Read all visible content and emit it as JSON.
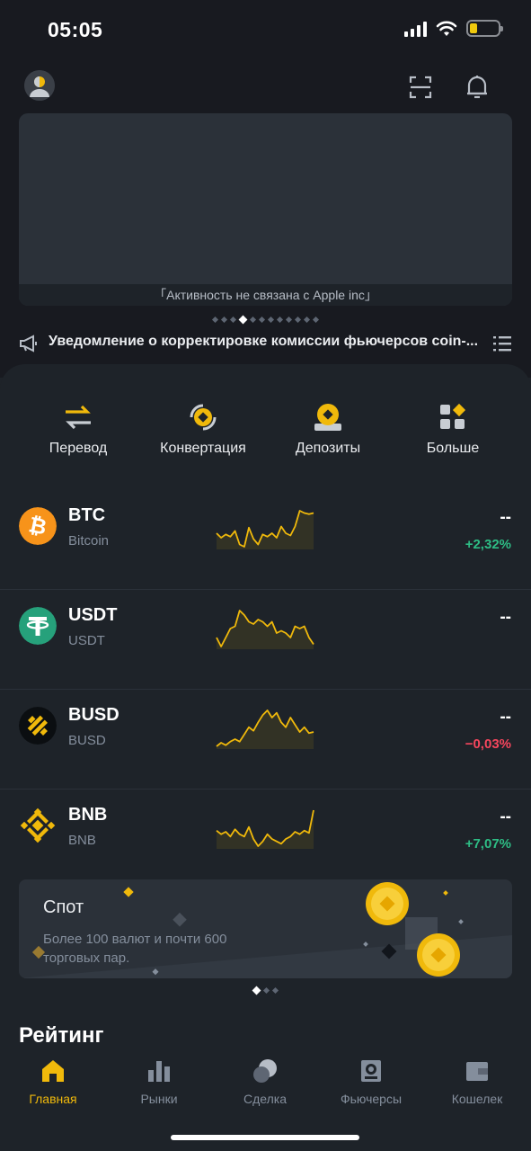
{
  "status": {
    "time": "05:05"
  },
  "banner": {
    "caption": "「Активность не связана с Apple inc」",
    "dot_count": 12,
    "active_dot": 3
  },
  "notice": {
    "text": "Уведомление о корректировке комиссии фьючерсов coin-..."
  },
  "actions": [
    {
      "label": "Перевод",
      "icon": "transfer-icon"
    },
    {
      "label": "Конвертация",
      "icon": "convert-icon"
    },
    {
      "label": "Депозиты",
      "icon": "deposit-icon"
    },
    {
      "label": "Больше",
      "icon": "more-icon"
    }
  ],
  "coins": [
    {
      "symbol": "BTC",
      "name": "Bitcoin",
      "price": "--",
      "change": "+2,32%",
      "change_color": "#2ebd85",
      "icon": "bitcoin-icon",
      "spark": [
        50,
        46,
        49,
        47,
        52,
        40,
        38,
        55,
        45,
        40,
        49,
        47,
        50,
        46,
        56,
        50,
        48,
        56,
        70,
        68,
        67,
        68
      ]
    },
    {
      "symbol": "USDT",
      "name": "USDT",
      "price": "--",
      "change": "",
      "change_color": "#2ebd85",
      "icon": "tether-icon",
      "spark": [
        40,
        36,
        40,
        44,
        45,
        52,
        50,
        47,
        46,
        48,
        47,
        45,
        47,
        42,
        43,
        42,
        40,
        45,
        44,
        45,
        40,
        37
      ]
    },
    {
      "symbol": "BUSD",
      "name": "BUSD",
      "price": "--",
      "change": "−0,03%",
      "change_color": "#f6465d",
      "icon": "busd-icon",
      "spark": [
        42,
        45,
        43,
        46,
        48,
        46,
        52,
        58,
        55,
        62,
        68,
        72,
        66,
        70,
        62,
        58,
        66,
        60,
        54,
        58,
        53,
        54
      ]
    },
    {
      "symbol": "BNB",
      "name": "BNB",
      "price": "--",
      "change": "+7,07%",
      "change_color": "#2ebd85",
      "icon": "bnb-icon",
      "spark": [
        55,
        52,
        54,
        50,
        56,
        52,
        50,
        58,
        48,
        42,
        46,
        52,
        48,
        46,
        44,
        48,
        50,
        54,
        52,
        55,
        53,
        72
      ]
    }
  ],
  "promo": {
    "title": "Спот",
    "text": "Более 100 валют и почти 600 торговых пар.",
    "dot_count": 3,
    "active_dot": 0
  },
  "rating": {
    "title": "Рейтинг"
  },
  "tabs": [
    {
      "label": "Главная",
      "icon": "home-icon",
      "active": true
    },
    {
      "label": "Рынки",
      "icon": "markets-icon",
      "active": false
    },
    {
      "label": "Сделка",
      "icon": "trade-icon",
      "active": false
    },
    {
      "label": "Фьючерсы",
      "icon": "futures-icon",
      "active": false
    },
    {
      "label": "Кошелек",
      "icon": "wallet-icon",
      "active": false
    }
  ],
  "colors": {
    "accent": "#f0b90b",
    "bg": "#1e2329",
    "top_bg": "#181a20",
    "card": "#2b3139",
    "muted": "#848e9c"
  }
}
